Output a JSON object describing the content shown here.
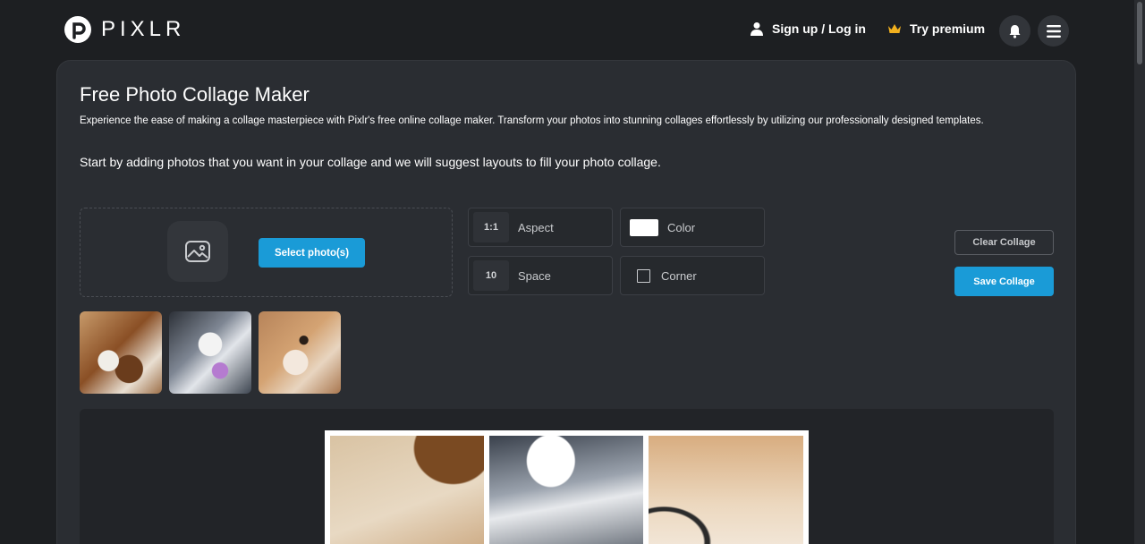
{
  "header": {
    "logo_text": "PIXLR",
    "signup_label": "Sign up / Log in",
    "premium_label": "Try premium"
  },
  "main": {
    "title": "Free Photo Collage Maker",
    "description": "Experience the ease of making a collage masterpiece with Pixlr's free online collage maker. Transform your photos into stunning collages effortlessly by utilizing our professionally designed templates.",
    "lead": "Start by adding photos that you want in your collage and we will suggest layouts to fill your photo collage."
  },
  "upload": {
    "select_label": "Select photo(s)"
  },
  "options": {
    "aspect_value": "1:1",
    "aspect_label": "Aspect",
    "space_value": "10",
    "space_label": "Space",
    "color_label": "Color",
    "color_value": "#ffffff",
    "corner_label": "Corner"
  },
  "actions": {
    "clear_label": "Clear Collage",
    "save_label": "Save Collage"
  },
  "photos": [
    "dog-photo-1",
    "husky-photo",
    "shiba-photo"
  ],
  "colors": {
    "accent": "#1a9bd7",
    "background": "#1d1f22",
    "panel": "#2a2d32",
    "crown": "#f2b01e"
  }
}
